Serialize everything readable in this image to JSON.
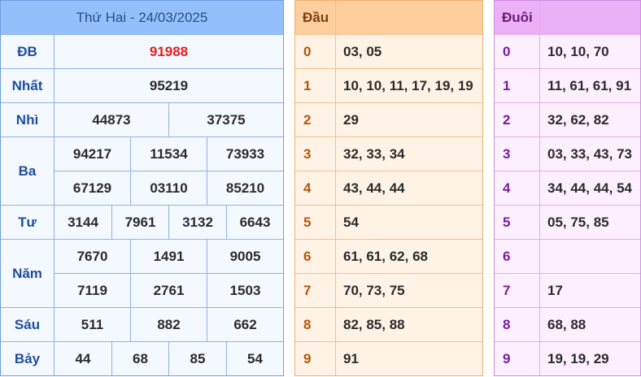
{
  "result": {
    "title": "Thứ Hai - 24/03/2025",
    "rows": {
      "db": {
        "label": "ĐB",
        "values": [
          "91988"
        ]
      },
      "nhat": {
        "label": "Nhất",
        "values": [
          "95219"
        ]
      },
      "nhi": {
        "label": "Nhì",
        "values": [
          "44873",
          "37375"
        ]
      },
      "ba": {
        "label": "Ba",
        "values": [
          "94217",
          "11534",
          "73933",
          "67129",
          "03110",
          "85210"
        ]
      },
      "tu": {
        "label": "Tư",
        "values": [
          "3144",
          "7961",
          "3132",
          "6643"
        ]
      },
      "nam": {
        "label": "Năm",
        "values": [
          "7670",
          "1491",
          "9005",
          "7119",
          "2761",
          "1503"
        ]
      },
      "sau": {
        "label": "Sáu",
        "values": [
          "511",
          "882",
          "662"
        ]
      },
      "bay": {
        "label": "Bảy",
        "values": [
          "44",
          "68",
          "85",
          "54"
        ]
      }
    }
  },
  "dau": {
    "header": "Đầu",
    "rows": [
      {
        "key": "0",
        "value": "03, 05"
      },
      {
        "key": "1",
        "value": "10, 10, 11, 17, 19, 19"
      },
      {
        "key": "2",
        "value": "29"
      },
      {
        "key": "3",
        "value": "32, 33, 34"
      },
      {
        "key": "4",
        "value": "43, 44, 44"
      },
      {
        "key": "5",
        "value": "54"
      },
      {
        "key": "6",
        "value": "61, 61, 62, 68"
      },
      {
        "key": "7",
        "value": "70, 73, 75"
      },
      {
        "key": "8",
        "value": "82, 85, 88"
      },
      {
        "key": "9",
        "value": "91"
      }
    ]
  },
  "duoi": {
    "header": "Đuôi",
    "rows": [
      {
        "key": "0",
        "value": "10, 10, 70"
      },
      {
        "key": "1",
        "value": "11, 61, 61, 91"
      },
      {
        "key": "2",
        "value": "32, 62, 82"
      },
      {
        "key": "3",
        "value": "03, 33, 43, 73"
      },
      {
        "key": "4",
        "value": "34, 44, 44, 54"
      },
      {
        "key": "5",
        "value": "05, 75, 85"
      },
      {
        "key": "6",
        "value": ""
      },
      {
        "key": "7",
        "value": "17"
      },
      {
        "key": "8",
        "value": "68, 88"
      },
      {
        "key": "9",
        "value": "19, 19, 29"
      }
    ]
  },
  "colors": {
    "result_header": "#93c0fa",
    "special_prize": "#ea1c1c",
    "dau_header": "#fccf9d",
    "duoi_header": "#ebb0f5"
  }
}
